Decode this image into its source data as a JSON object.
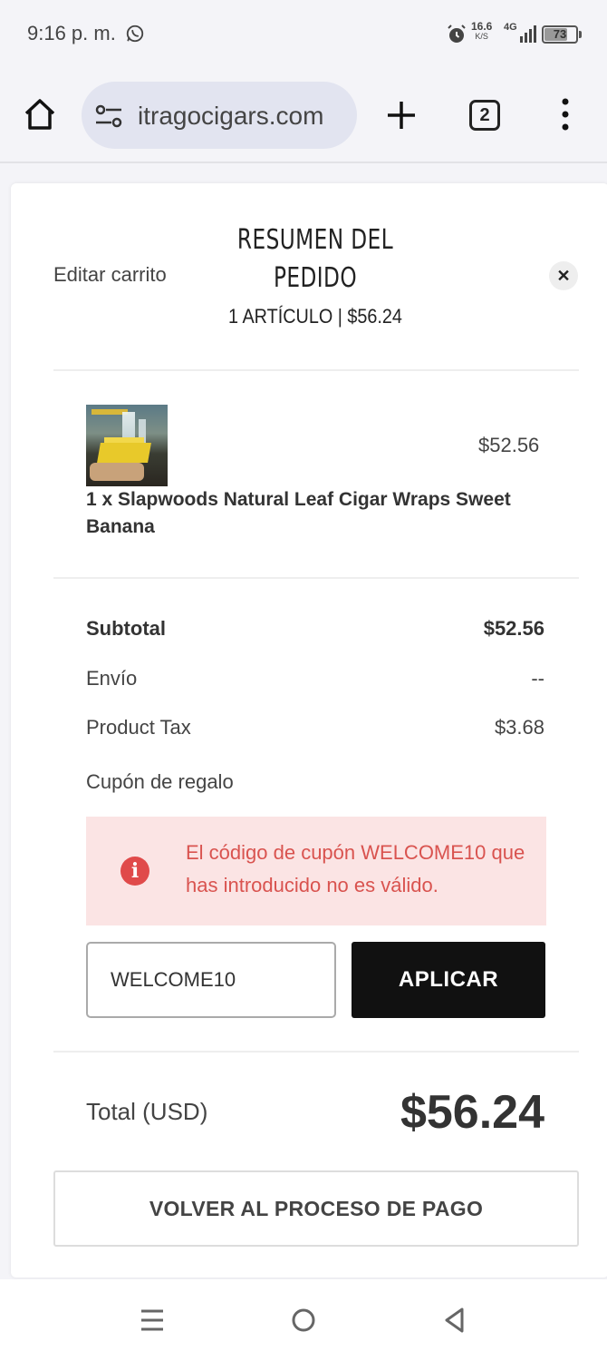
{
  "status_bar": {
    "time": "9:16 p. m.",
    "speed_value": "16.6",
    "speed_unit": "K/S",
    "network": "4G",
    "battery": "73"
  },
  "browser": {
    "url": "itragocigars.com",
    "tab_count": "2"
  },
  "cart": {
    "edit_label": "Editar carrito",
    "title": "RESUMEN DEL PEDIDO",
    "subtitle": "1 ARTÍCULO | $56.24",
    "close_label": "✕"
  },
  "product": {
    "name": "1 x Slapwoods Natural Leaf Cigar Wraps Sweet Banana",
    "price": "$52.56"
  },
  "totals": {
    "subtotal_label": "Subtotal",
    "subtotal_value": "$52.56",
    "shipping_label": "Envío",
    "shipping_value": "--",
    "tax_label": "Product Tax",
    "tax_value": "$3.68",
    "coupon_label": "Cupón de regalo"
  },
  "coupon": {
    "error_message": "El código de cupón WELCOME10 que has introducido no es válido.",
    "input_value": "WELCOME10",
    "apply_label": "APLICAR"
  },
  "total": {
    "label": "Total (USD)",
    "value": "$56.24"
  },
  "checkout_button": "VOLVER AL PROCESO DE PAGO",
  "colors": {
    "error_bg": "#fbe4e4",
    "error_text": "#d9534f",
    "button_dark": "#111111"
  }
}
